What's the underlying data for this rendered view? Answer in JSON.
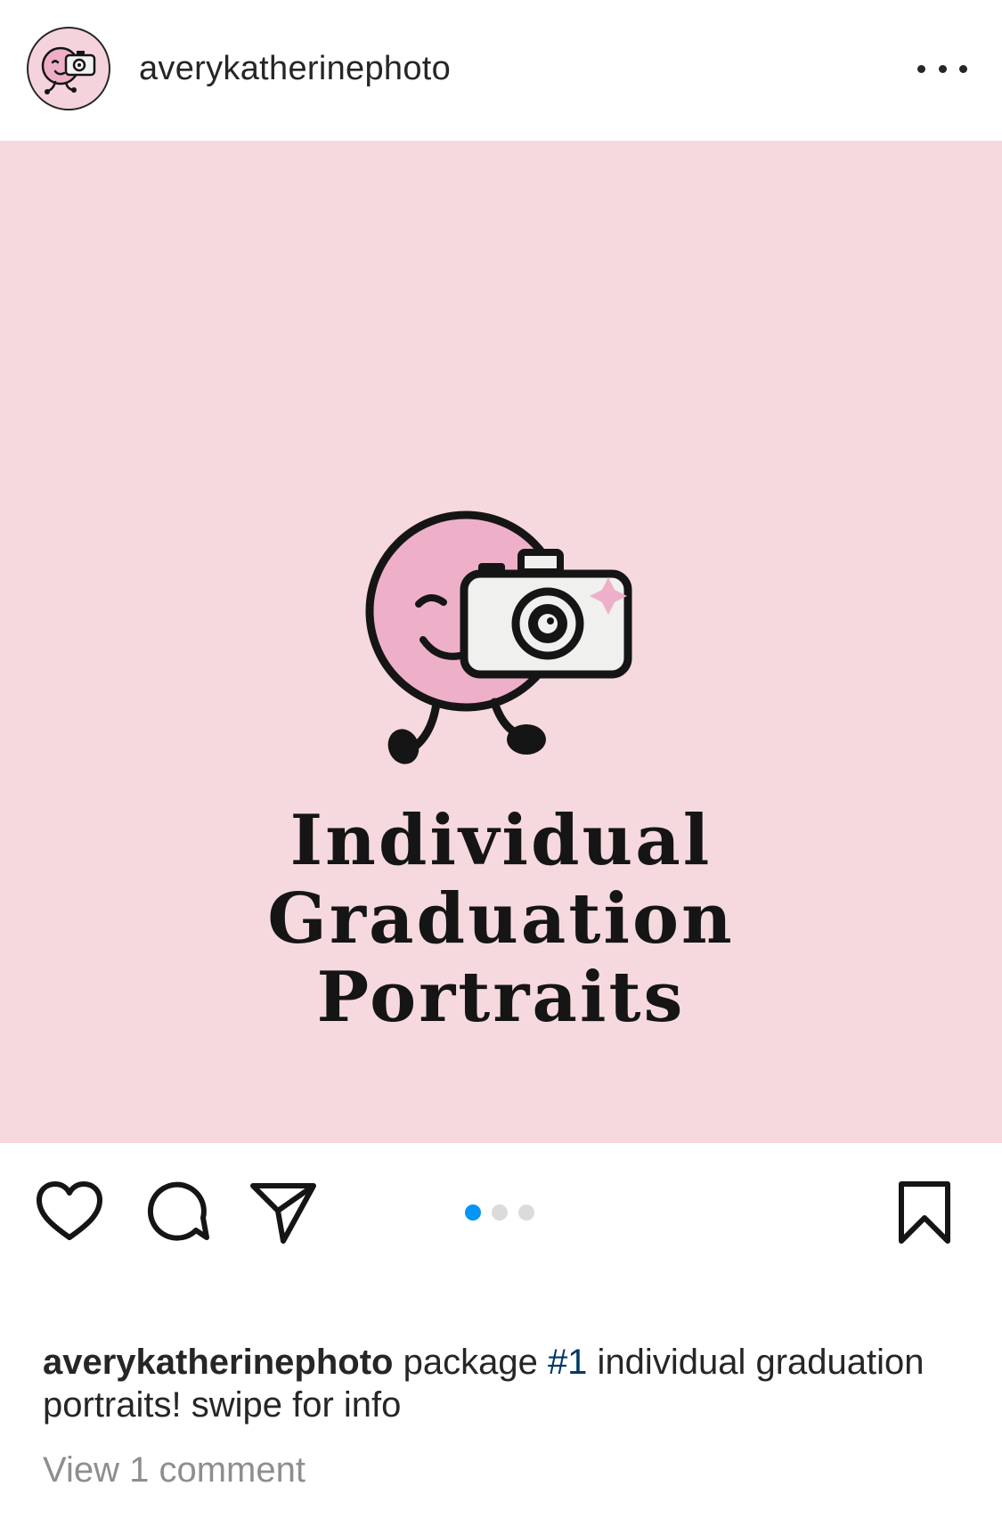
{
  "header": {
    "username": "averykatherinephoto",
    "avatar_icon": "camera-mascot-logo",
    "more_icon": "more-horizontal-icon"
  },
  "post": {
    "background_color": "#f6d9df",
    "graphic_icon": "camera-mascot-logo",
    "title_lines": [
      "Individual",
      "Graduation",
      "Portraits"
    ]
  },
  "actions": {
    "like_icon": "heart-icon",
    "comment_icon": "comment-bubble-icon",
    "share_icon": "paper-plane-icon",
    "save_icon": "bookmark-icon",
    "carousel": {
      "total": 3,
      "active_index": 0,
      "active_color": "#0095f6",
      "inactive_color": "#dbdbdb"
    }
  },
  "caption": {
    "username": "averykatherinephoto",
    "text_before": " package ",
    "hashtag": "#1",
    "text_after": " individual graduation portraits! swipe for info"
  },
  "comments": {
    "view_label": "View 1 comment"
  }
}
